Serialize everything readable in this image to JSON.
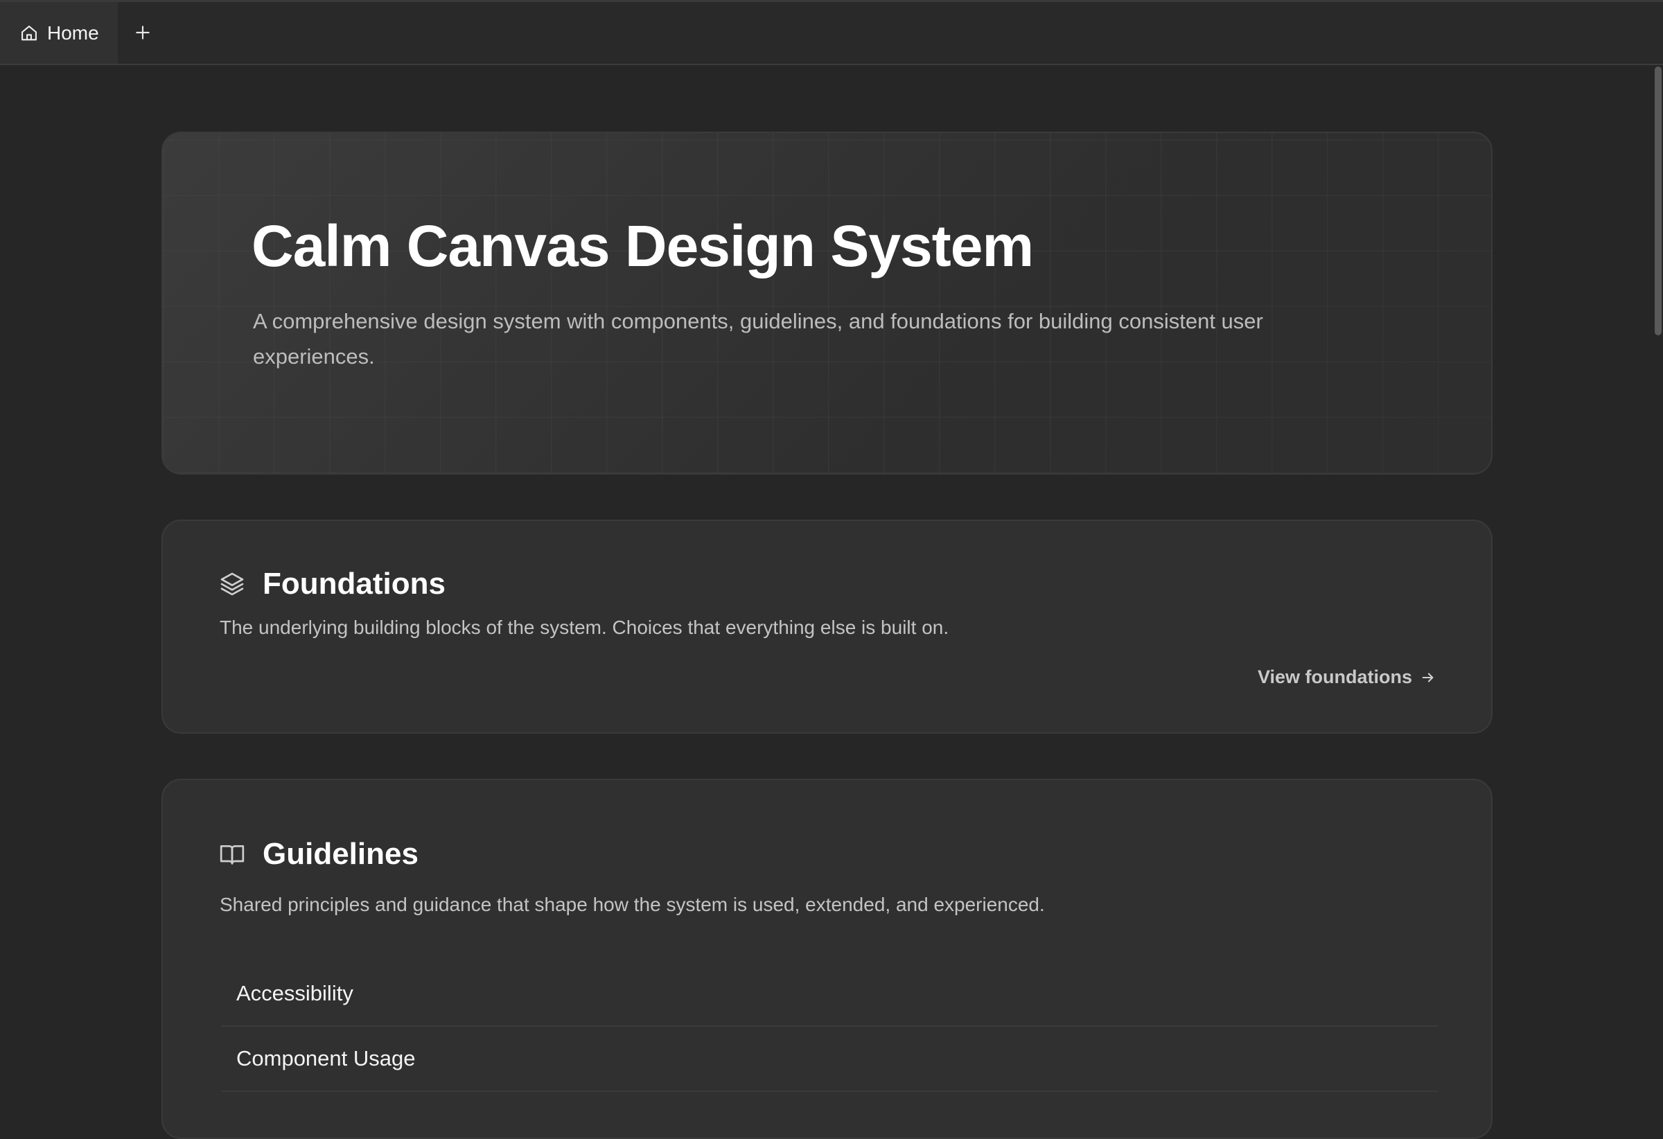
{
  "tabs": {
    "home_label": "Home",
    "add_icon": "plus-icon",
    "home_icon": "home-icon"
  },
  "hero": {
    "title": "Calm Canvas Design System",
    "subtitle": "A comprehensive design system with components, guidelines, and foundations for building consistent user experiences."
  },
  "foundations": {
    "icon": "layers-icon",
    "title": "Foundations",
    "description": "The underlying building blocks of the system. Choices that everything else is built on.",
    "link_label": "View foundations",
    "link_icon": "arrow-right-icon"
  },
  "guidelines": {
    "icon": "book-open-icon",
    "title": "Guidelines",
    "description": "Shared principles and guidance that shape how the system is used, extended, and experienced.",
    "items": [
      "Accessibility",
      "Component Usage"
    ]
  },
  "colors": {
    "background": "#262626",
    "card": "#303030",
    "border": "#3a3a3a",
    "text": "#ffffff",
    "muted": "#c4c4c4"
  }
}
